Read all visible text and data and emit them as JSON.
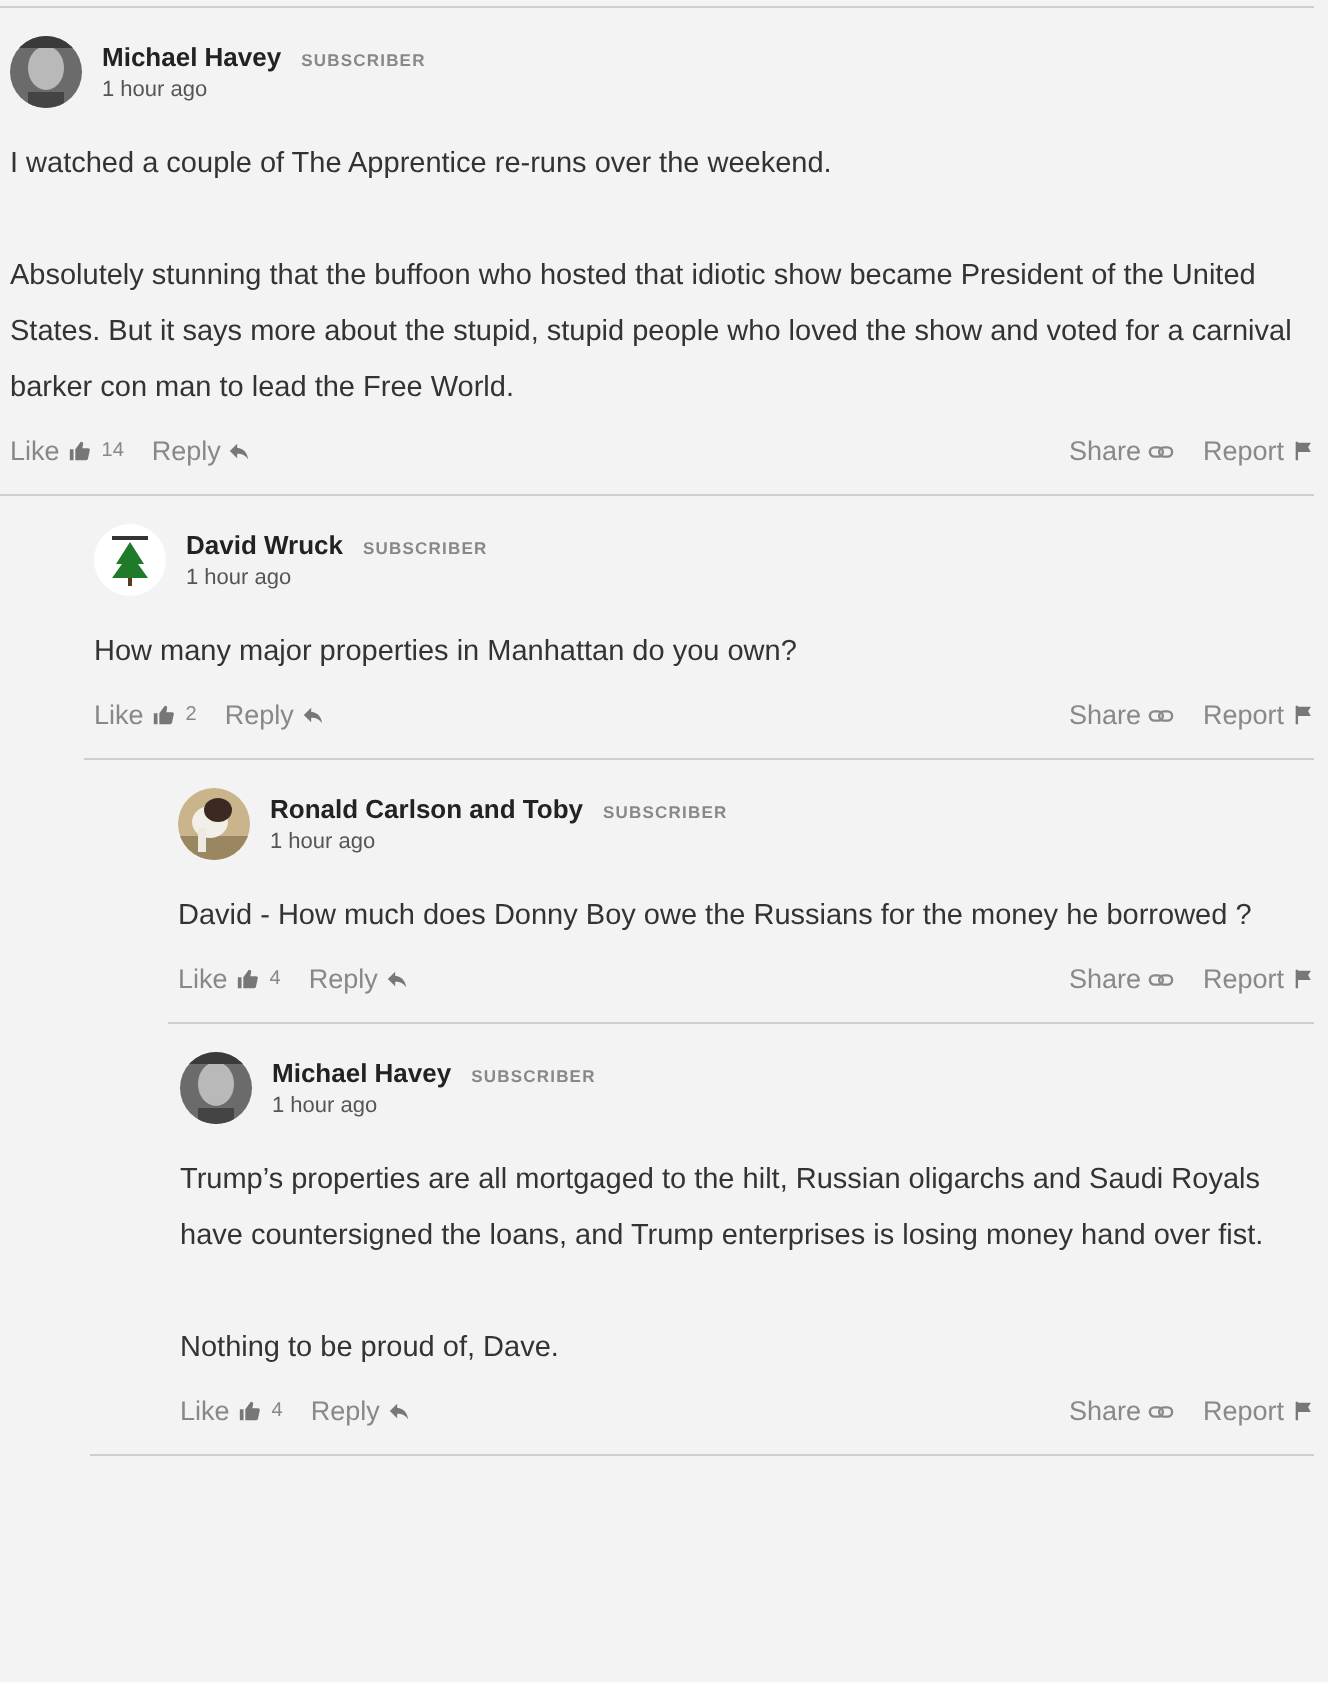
{
  "comments": [
    {
      "author": "Michael Havey",
      "badge": "SUBSCRIBER",
      "time": "1 hour ago",
      "paragraphs": [
        "I watched a couple of The Apprentice re-runs over the weekend.",
        "Absolutely stunning that the buffoon who hosted that idiotic show became President of the United States. But it says more about the stupid, stupid people who loved the show and voted for a carnival barker con man to lead the Free World."
      ],
      "like": "Like",
      "likes": "14",
      "reply": "Reply",
      "share": "Share",
      "report": "Report",
      "children": [
        {
          "author": "David Wruck",
          "badge": "SUBSCRIBER",
          "time": "1 hour ago",
          "paragraphs": [
            "How many major properties in Manhattan do you own?"
          ],
          "like": "Like",
          "likes": "2",
          "reply": "Reply",
          "share": "Share",
          "report": "Report",
          "children": [
            {
              "author": "Ronald Carlson and Toby",
              "badge": "SUBSCRIBER",
              "time": "1 hour ago",
              "paragraphs": [
                "David - How much does Donny Boy owe the Russians for the money he borrowed ?"
              ],
              "like": "Like",
              "likes": "4",
              "reply": "Reply",
              "share": "Share",
              "report": "Report"
            },
            {
              "author": "Michael Havey",
              "badge": "SUBSCRIBER",
              "time": "1 hour ago",
              "paragraphs": [
                "Trump’s properties are all mortgaged to the hilt, Russian oligarchs and Saudi Royals have countersigned the loans, and Trump enterprises is losing money hand over fist.",
                "Nothing to be proud of, Dave."
              ],
              "like": "Like",
              "likes": "4",
              "reply": "Reply",
              "share": "Share",
              "report": "Report"
            }
          ]
        }
      ]
    }
  ]
}
